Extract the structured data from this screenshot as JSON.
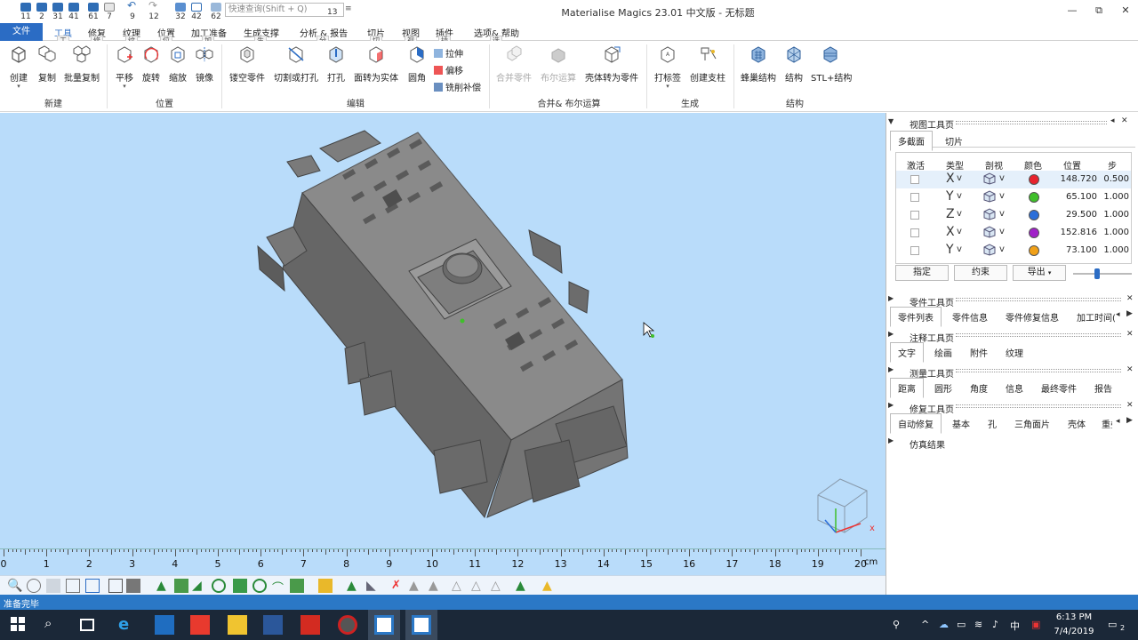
{
  "window": {
    "title": "Materialise Magics 23.01 中文版 - 无标题",
    "min_label": "—",
    "restore_label": "⧉",
    "close_label": "✕"
  },
  "qat": {
    "items": [
      "11",
      "2",
      "31",
      "41",
      "61",
      "7",
      "9",
      "12",
      "32",
      "42",
      "62"
    ],
    "search_placeholder": "快速查询(Shift + Q)",
    "search_key": "13"
  },
  "tabs": {
    "file": "文件",
    "items": [
      {
        "label": "工具",
        "key": "工"
      },
      {
        "label": "修复",
        "key": "修"
      },
      {
        "label": "纹理",
        "key": "纹"
      },
      {
        "label": "位置",
        "key": "位"
      },
      {
        "label": "加工准备",
        "key": "加"
      },
      {
        "label": "生成支撑",
        "key": "生"
      },
      {
        "label": "分析 & 报告",
        "key": "分"
      },
      {
        "label": "切片",
        "key": "切"
      },
      {
        "label": "视图",
        "key": "视"
      },
      {
        "label": "插件",
        "key": "插"
      },
      {
        "label": "选项& 帮助",
        "key": "选"
      }
    ]
  },
  "ribbon": {
    "groups": {
      "new": "新建",
      "position": "位置",
      "edit": "编辑",
      "merge": "合并& 布尔运算",
      "generate": "生成",
      "structure": "结构"
    },
    "buttons": {
      "create": "创建",
      "copy": "复制",
      "batch_copy": "批量复制",
      "translate": "平移",
      "rotate": "旋转",
      "scale": "缩放",
      "mirror": "镜像",
      "hollow": "镂空零件",
      "cut_punch": "切割或打孔",
      "punch": "打孔",
      "surface_solid": "面转为实体",
      "fillet": "圆角",
      "extrude": "拉伸",
      "offset": "偏移",
      "mill_comp": "铣削补偿",
      "merge_parts": "合并零件",
      "boolean": "布尔运算",
      "shell_part": "壳体转为零件",
      "label": "打标签",
      "support_post": "创建支柱",
      "honeycomb": "蜂巢结构",
      "structure": "结构",
      "stl_structure": "STL+结构"
    }
  },
  "ruler": {
    "numbers": [
      "0",
      "1",
      "2",
      "3",
      "4",
      "5",
      "6",
      "7",
      "8",
      "9",
      "10",
      "11",
      "12",
      "13",
      "14",
      "15",
      "16",
      "17",
      "18",
      "19",
      "20"
    ],
    "unit": "cm"
  },
  "panel": {
    "view_tools": {
      "title": "视图工具页",
      "tabs": [
        "多截面",
        "切片"
      ],
      "headers": [
        "激活",
        "类型",
        "剖视",
        "颜色",
        "位置",
        "步"
      ],
      "rows": [
        {
          "axis": "X",
          "color": "#e8232e",
          "position": "148.720",
          "step": "0.500"
        },
        {
          "axis": "Y",
          "color": "#3fbf2a",
          "position": "65.100",
          "step": "1.000"
        },
        {
          "axis": "Z",
          "color": "#2b6ed9",
          "position": "29.500",
          "step": "1.000"
        },
        {
          "axis": "X",
          "color": "#a020c8",
          "position": "152.816",
          "step": "1.000"
        },
        {
          "axis": "Y",
          "color": "#f0a018",
          "position": "73.100",
          "step": "1.000"
        }
      ],
      "buttons": {
        "assign": "指定",
        "constrain": "约束",
        "export": "导出"
      }
    },
    "part_tools": {
      "title": "零件工具页",
      "tabs": [
        "零件列表",
        "零件信息",
        "零件修复信息",
        "加工时间("
      ]
    },
    "annotation_tools": {
      "title": "注释工具页",
      "tabs": [
        "文字",
        "绘画",
        "附件",
        "纹理"
      ]
    },
    "measure_tools": {
      "title": "测量工具页",
      "tabs": [
        "距离",
        "圆形",
        "角度",
        "信息",
        "最终零件",
        "报告"
      ]
    },
    "repair_tools": {
      "title": "修复工具页",
      "tabs": [
        "自动修复",
        "基本",
        "孔",
        "三角面片",
        "壳体",
        "重叠"
      ]
    },
    "simulation": {
      "title": "仿真结果"
    }
  },
  "status": {
    "text": "准备完毕"
  },
  "taskbar": {
    "time": "6:13 PM",
    "date": "7/4/2019",
    "ime": "中",
    "notif_count": "2"
  },
  "colors": {
    "accent": "#2b6cc4",
    "viewport_bg": "#b9dcfa",
    "model": "#7a7a7a",
    "statusbar": "#2b78c6",
    "taskbar": "#1b2838"
  }
}
